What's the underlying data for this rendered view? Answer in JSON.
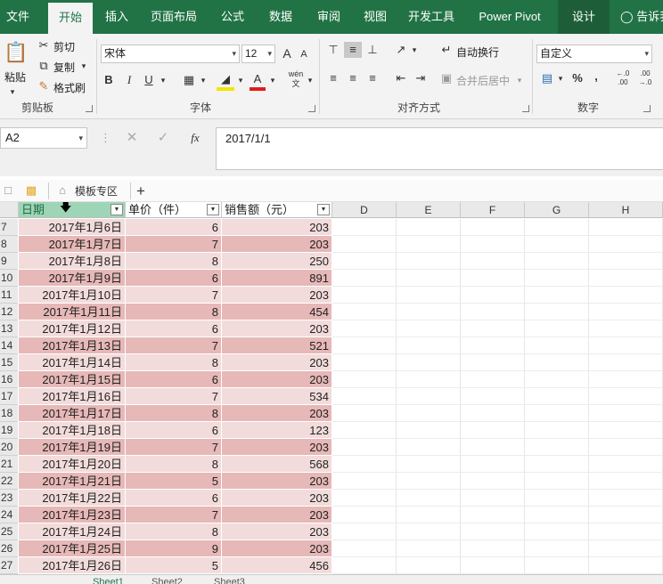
{
  "tabs": [
    {
      "label": "文件"
    },
    {
      "label": "开始"
    },
    {
      "label": "插入"
    },
    {
      "label": "页面布局"
    },
    {
      "label": "公式"
    },
    {
      "label": "数据"
    },
    {
      "label": "审阅"
    },
    {
      "label": "视图"
    },
    {
      "label": "开发工具"
    },
    {
      "label": "Power Pivot"
    },
    {
      "label": "设计"
    },
    {
      "label": "告诉我"
    }
  ],
  "clipboard": {
    "paste": "粘贴",
    "cut": "剪切",
    "copy": "复制",
    "format_painter": "格式刷",
    "group": "剪贴板"
  },
  "font": {
    "name": "宋体",
    "size": "12",
    "group": "字体",
    "bold": "B",
    "italic": "I",
    "underline": "U",
    "grow": "A",
    "shrink": "A",
    "phonetic": "wén"
  },
  "alignment": {
    "wrap": "自动换行",
    "merge": "合并后居中",
    "group": "对齐方式"
  },
  "number": {
    "format": "自定义",
    "percent": "%",
    "comma": ",",
    "group": "数字"
  },
  "formula_bar": {
    "name_box": "A2",
    "fx": "fx",
    "value": "2017/1/1"
  },
  "quickbar": {
    "template_zone": "模板专区",
    "add": "+"
  },
  "columns": [
    "日期",
    "单价（件）",
    "销售额（元）",
    "D",
    "E",
    "F",
    "G",
    "H"
  ],
  "rows": [
    {
      "num": "7",
      "date": "2017年1月6日",
      "price": "6",
      "sales": "203"
    },
    {
      "num": "8",
      "date": "2017年1月7日",
      "price": "7",
      "sales": "203"
    },
    {
      "num": "9",
      "date": "2017年1月8日",
      "price": "8",
      "sales": "250"
    },
    {
      "num": "10",
      "date": "2017年1月9日",
      "price": "6",
      "sales": "891"
    },
    {
      "num": "11",
      "date": "2017年1月10日",
      "price": "7",
      "sales": "203"
    },
    {
      "num": "12",
      "date": "2017年1月11日",
      "price": "8",
      "sales": "454"
    },
    {
      "num": "13",
      "date": "2017年1月12日",
      "price": "6",
      "sales": "203"
    },
    {
      "num": "14",
      "date": "2017年1月13日",
      "price": "7",
      "sales": "521"
    },
    {
      "num": "15",
      "date": "2017年1月14日",
      "price": "8",
      "sales": "203"
    },
    {
      "num": "16",
      "date": "2017年1月15日",
      "price": "6",
      "sales": "203"
    },
    {
      "num": "17",
      "date": "2017年1月16日",
      "price": "7",
      "sales": "534"
    },
    {
      "num": "18",
      "date": "2017年1月17日",
      "price": "8",
      "sales": "203"
    },
    {
      "num": "19",
      "date": "2017年1月18日",
      "price": "6",
      "sales": "123"
    },
    {
      "num": "20",
      "date": "2017年1月19日",
      "price": "7",
      "sales": "203"
    },
    {
      "num": "21",
      "date": "2017年1月20日",
      "price": "8",
      "sales": "568"
    },
    {
      "num": "22",
      "date": "2017年1月21日",
      "price": "5",
      "sales": "203"
    },
    {
      "num": "23",
      "date": "2017年1月22日",
      "price": "6",
      "sales": "203"
    },
    {
      "num": "24",
      "date": "2017年1月23日",
      "price": "7",
      "sales": "203"
    },
    {
      "num": "25",
      "date": "2017年1月24日",
      "price": "8",
      "sales": "203"
    },
    {
      "num": "26",
      "date": "2017年1月25日",
      "price": "9",
      "sales": "203"
    },
    {
      "num": "27",
      "date": "2017年1月26日",
      "price": "5",
      "sales": "456"
    }
  ],
  "sheets": [
    "Sheet1",
    "Sheet2",
    "Sheet3"
  ],
  "colors": {
    "ribbon": "#217346",
    "band_light": "#f2dcdb",
    "band_dark": "#e6b8b7",
    "header_selected": "#9fd5b7"
  }
}
